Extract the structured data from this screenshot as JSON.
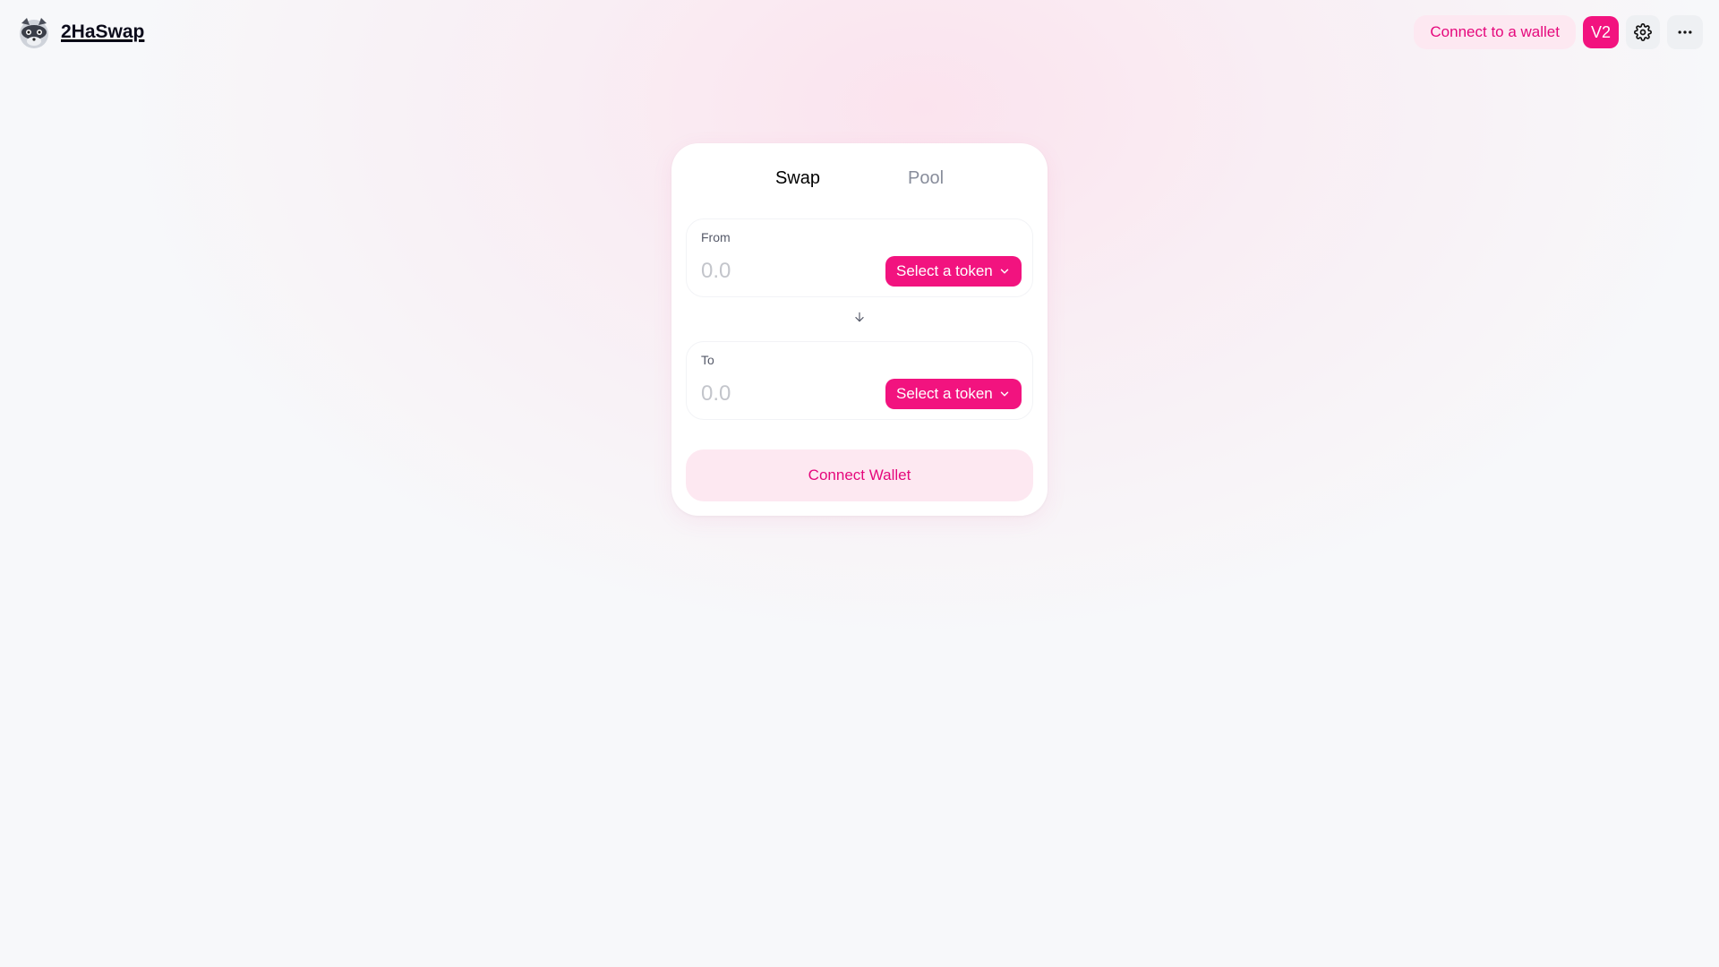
{
  "brand": {
    "name": "2HaSwap",
    "logo_icon": "raccoon-logo-icon"
  },
  "header": {
    "connect_label": "Connect to a wallet",
    "version_badge": "V2",
    "settings_icon": "gear-icon",
    "more_icon": "more-dots-icon"
  },
  "tabs": [
    {
      "label": "Swap",
      "active": true
    },
    {
      "label": "Pool",
      "active": false
    }
  ],
  "from": {
    "label": "From",
    "placeholder": "0.0",
    "token_button": "Select a token"
  },
  "switch_icon": "arrow-down-icon",
  "to": {
    "label": "To",
    "placeholder": "0.0",
    "token_button": "Select a token"
  },
  "connect_wallet_label": "Connect Wallet",
  "colors": {
    "accent": "#f2137f",
    "accent_light": "#fde8f1",
    "accent_text": "#e5087c"
  }
}
